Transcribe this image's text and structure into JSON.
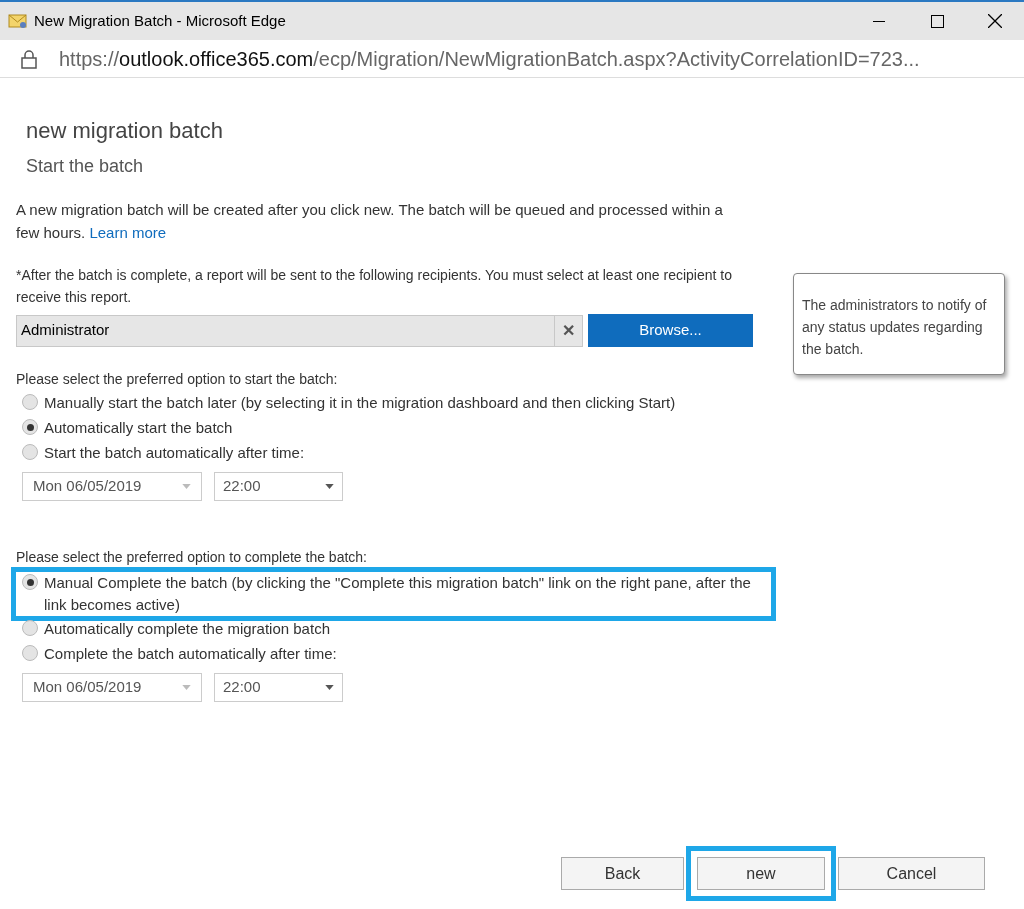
{
  "window": {
    "title": "New Migration Batch - Microsoft Edge"
  },
  "address_bar": {
    "scheme": "https://",
    "host": "outlook.office365.com",
    "path": "/ecp/Migration/NewMigrationBatch.aspx?ActivityCorrelationID=723..."
  },
  "heading": "new migration batch",
  "subheading": "Start the batch",
  "intro": {
    "text": "A new migration batch will be created after you click new. The batch will be queued and processed within a few hours.",
    "link": "Learn more"
  },
  "recipients": {
    "label": "*After the batch is complete, a report will be sent to the following recipients. You must select at least one recipient to receive this report.",
    "value": "Administrator",
    "clear": "✕",
    "browse": "Browse..."
  },
  "tooltip": "The administrators to notify of any status updates regarding the batch.",
  "start_options": {
    "label": "Please select the preferred option to start the batch:",
    "options": [
      {
        "label": "Manually start the batch later (by selecting it in the migration dashboard and then clicking Start)",
        "selected": false,
        "highlighted": false
      },
      {
        "label": "Automatically start the batch",
        "selected": true,
        "highlighted": false
      },
      {
        "label": "Start the batch automatically after time:",
        "selected": false,
        "highlighted": false
      }
    ],
    "date": "Mon 06/05/2019",
    "time": "22:00"
  },
  "complete_options": {
    "label": "Please select the preferred option to complete the batch:",
    "options": [
      {
        "label": "Manual Complete the batch (by clicking the \"Complete this migration batch\" link on the right pane, after the link becomes active)",
        "selected": true,
        "highlighted": true
      },
      {
        "label": "Automatically complete the migration batch",
        "selected": false,
        "highlighted": false
      },
      {
        "label": "Complete the batch automatically after time:",
        "selected": false,
        "highlighted": false
      }
    ],
    "date": "Mon 06/05/2019",
    "time": "22:00"
  },
  "buttons": [
    {
      "label": "Back",
      "highlighted": false
    },
    {
      "label": "new",
      "highlighted": true
    },
    {
      "label": "Cancel",
      "highlighted": false
    }
  ]
}
